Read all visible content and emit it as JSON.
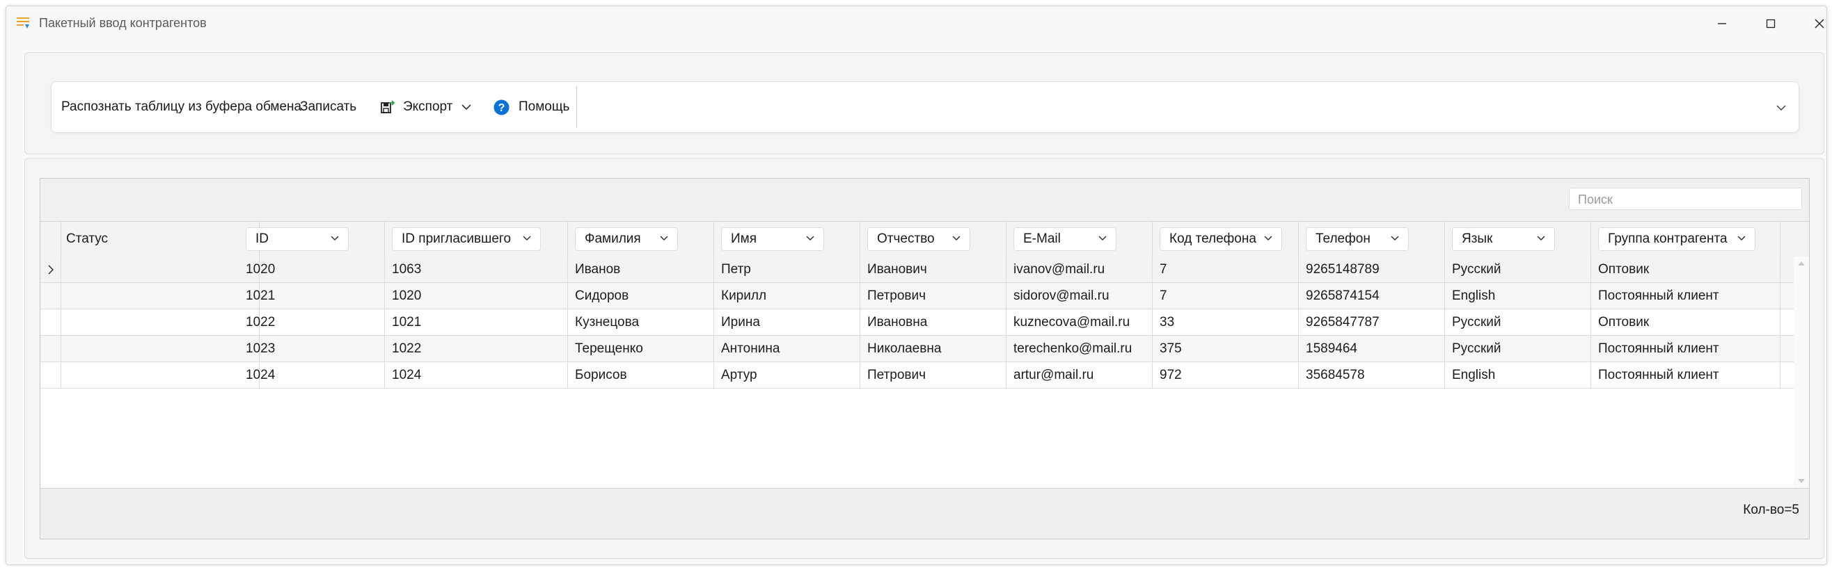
{
  "window": {
    "title": "Пакетный ввод контрагентов"
  },
  "toolbar": {
    "recognize_label": "Распознать таблицу из буфера обмена",
    "save_label": "Записать",
    "export_label": "Экспорт",
    "help_label": "Помощь"
  },
  "grid": {
    "search_placeholder": "Поиск",
    "status_header": "Статус",
    "columns": [
      "ID",
      "ID пригласившего",
      "Фамилия",
      "Имя",
      "Отчество",
      "E-Mail",
      "Код телефона",
      "Телефон",
      "Язык",
      "Группа контрагента"
    ],
    "rows": [
      [
        "1020",
        "1063",
        "Иванов",
        "Петр",
        "Иванович",
        "ivanov@mail.ru",
        "7",
        "9265148789",
        "Русский",
        "Оптовик"
      ],
      [
        "1021",
        "1020",
        "Сидоров",
        "Кирилл",
        "Петрович",
        "sidorov@mail.ru",
        "7",
        "9265874154",
        "English",
        "Постоянный клиент"
      ],
      [
        "1022",
        "1021",
        "Кузнецова",
        "Ирина",
        "Ивановна",
        "kuznecova@mail.ru",
        "33",
        "9265847787",
        "Русский",
        "Оптовик"
      ],
      [
        "1023",
        "1022",
        "Терещенко",
        "Антонина",
        "Николаевна",
        "terechenko@mail.ru",
        "375",
        "1589464",
        "Русский",
        "Постоянный клиент"
      ],
      [
        "1024",
        "1024",
        "Борисов",
        "Артур",
        "Петрович",
        "artur@mail.ru",
        "972",
        "35684578",
        "English",
        "Постоянный клиент"
      ]
    ],
    "count_label": "Кол-во=5"
  },
  "icons": {
    "app": "menu-lines-icon",
    "export": "export-save-icon",
    "help": "help-circle-icon",
    "row_indicator": "chevron-right-icon",
    "collapse": "chevron-down-icon"
  },
  "colors": {
    "help_blue": "#0a72d6",
    "export_green": "#2e9c4a"
  }
}
